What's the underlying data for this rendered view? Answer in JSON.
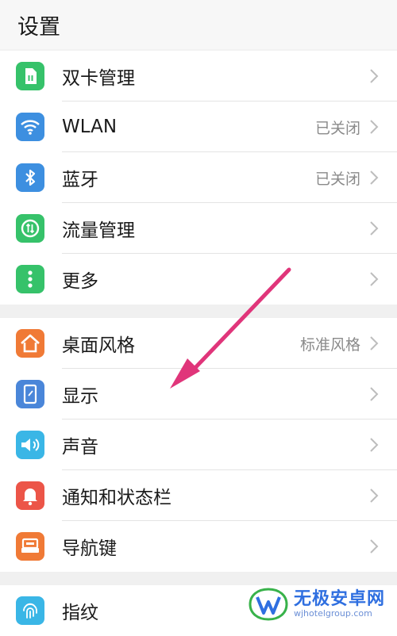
{
  "header": {
    "title": "设置"
  },
  "groups": [
    {
      "items": [
        {
          "label": "双卡管理",
          "value": "",
          "icon": "sim-card-icon",
          "color": "#36c26a"
        },
        {
          "label": "WLAN",
          "value": "已关闭",
          "icon": "wifi-icon",
          "color": "#3d8fe0"
        },
        {
          "label": "蓝牙",
          "value": "已关闭",
          "icon": "bluetooth-icon",
          "color": "#3d8fe0"
        },
        {
          "label": "流量管理",
          "value": "",
          "icon": "data-usage-icon",
          "color": "#36c26a"
        },
        {
          "label": "更多",
          "value": "",
          "icon": "more-icon",
          "color": "#36c26a"
        }
      ]
    },
    {
      "items": [
        {
          "label": "桌面风格",
          "value": "标准风格",
          "icon": "home-icon",
          "color": "#f07a36"
        },
        {
          "label": "显示",
          "value": "",
          "icon": "display-icon",
          "color": "#4a86d9"
        },
        {
          "label": "声音",
          "value": "",
          "icon": "speaker-icon",
          "color": "#3ab6e6"
        },
        {
          "label": "通知和状态栏",
          "value": "",
          "icon": "bell-icon",
          "color": "#ec5548"
        },
        {
          "label": "导航键",
          "value": "",
          "icon": "navigation-key-icon",
          "color": "#f07a36"
        }
      ]
    },
    {
      "items": [
        {
          "label": "指纹",
          "value": "",
          "icon": "fingerprint-icon",
          "color": "#3ab6e6"
        }
      ]
    }
  ],
  "annotation": {
    "arrow_color": "#e0357a"
  },
  "watermark": {
    "name": "无极安卓网",
    "url": "wjhotelgroup.com",
    "color": "#2f6fe0"
  }
}
